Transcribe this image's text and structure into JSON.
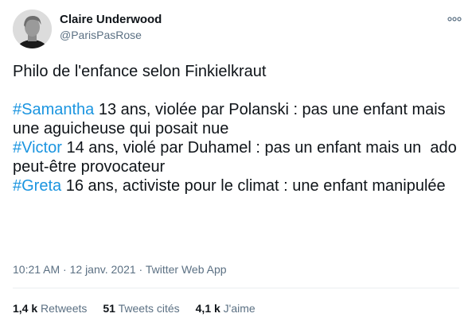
{
  "author": {
    "name": "Claire Underwood",
    "handle": "@ParisPasRose"
  },
  "tweet": {
    "line1": "Philo de l'enfance selon Finkielkraut",
    "items": [
      {
        "hashtag": "#Samantha",
        "text": " 13 ans, violée par Polanski : pas une enfant mais une aguicheuse qui posait nue"
      },
      {
        "hashtag": "#Victor",
        "text": " 14 ans, violé par Duhamel : pas un enfant mais un  ado peut-être provocateur"
      },
      {
        "hashtag": "#Greta",
        "text": " 16 ans, activiste pour le climat : une enfant manipulée"
      }
    ]
  },
  "meta": {
    "time": "10:21 AM",
    "separator": " · ",
    "date": "12 janv. 2021",
    "app": "Twitter Web App"
  },
  "stats": {
    "retweets_count": "1,4 k",
    "retweets_label": "Retweets",
    "quotes_count": "51",
    "quotes_label": "Tweets cités",
    "likes_count": "4,1 k",
    "likes_label": "J'aime"
  },
  "colors": {
    "hashtag": "#1b95e0",
    "secondary_text": "#5b7083",
    "divider": "#ebeef0"
  },
  "icons": {
    "more": "more-horizontal-icon"
  }
}
